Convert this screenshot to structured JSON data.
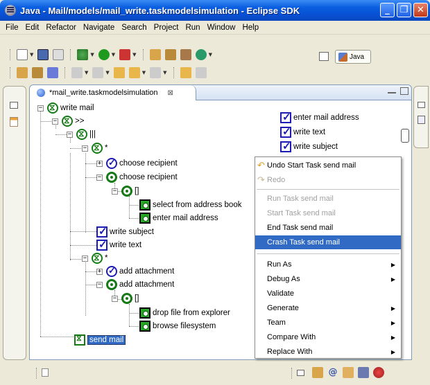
{
  "window": {
    "title": "Java - Mail/models/mail_write.taskmodelsimulation - Eclipse SDK",
    "minimize_glyph": "_",
    "restore_glyph": "❐",
    "close_glyph": "✕"
  },
  "menubar": {
    "items": [
      "File",
      "Edit",
      "Refactor",
      "Navigate",
      "Search",
      "Project",
      "Run",
      "Window",
      "Help"
    ]
  },
  "perspective": {
    "label": "Java"
  },
  "editor": {
    "tab_label": "*mail_write.taskmodelsimulation",
    "tab_close": "⊠"
  },
  "tree": {
    "nodes": [
      {
        "label": "write mail",
        "icon": "loop-icon"
      },
      {
        "label": ">>",
        "icon": "loop-icon"
      },
      {
        "label": "|||",
        "icon": "loop-icon"
      },
      {
        "label": "*",
        "icon": "loop-icon"
      },
      {
        "label": "choose recipient",
        "icon": "circle-check-icon"
      },
      {
        "label": "choose recipient",
        "icon": "sequence-icon"
      },
      {
        "label": "[]",
        "icon": "sequence-icon"
      },
      {
        "label": "select from address book",
        "icon": "leaf-task-icon"
      },
      {
        "label": "enter mail address",
        "icon": "leaf-task-icon"
      },
      {
        "label": "write subject",
        "icon": "checkbox-icon"
      },
      {
        "label": "write text",
        "icon": "checkbox-icon"
      },
      {
        "label": "*",
        "icon": "loop-icon"
      },
      {
        "label": "add attachment",
        "icon": "circle-check-icon"
      },
      {
        "label": "add attachment",
        "icon": "sequence-icon"
      },
      {
        "label": "[]",
        "icon": "sequence-icon"
      },
      {
        "label": "drop file from explorer",
        "icon": "leaf-task-icon"
      },
      {
        "label": "browse filesystem",
        "icon": "leaf-task-icon"
      },
      {
        "label": "send mail",
        "icon": "running-task-icon"
      }
    ]
  },
  "history": {
    "items": [
      "enter mail address",
      "write text",
      "write subject"
    ]
  },
  "context_menu": {
    "items": [
      {
        "label": "Undo Start Task send mail",
        "state": "enabled",
        "icon": "undo-icon"
      },
      {
        "label": "Redo",
        "state": "disabled",
        "icon": "redo-icon"
      },
      {
        "label": "Run Task send mail",
        "state": "disabled"
      },
      {
        "label": "Start Task send mail",
        "state": "disabled"
      },
      {
        "label": "End Task send mail",
        "state": "enabled"
      },
      {
        "label": "Crash Task send mail",
        "state": "highlighted"
      },
      {
        "label": "Run As",
        "state": "submenu"
      },
      {
        "label": "Debug As",
        "state": "submenu"
      },
      {
        "label": "Validate",
        "state": "enabled"
      },
      {
        "label": "Generate",
        "state": "submenu"
      },
      {
        "label": "Team",
        "state": "submenu"
      },
      {
        "label": "Compare With",
        "state": "submenu"
      },
      {
        "label": "Replace With",
        "state": "submenu"
      }
    ],
    "submenu_arrow": "▶"
  },
  "colors": {
    "title_blue": "#0a5fe0",
    "selection": "#316ac5",
    "task_green": "#157a15",
    "check_blue": "#1c1cb4"
  }
}
